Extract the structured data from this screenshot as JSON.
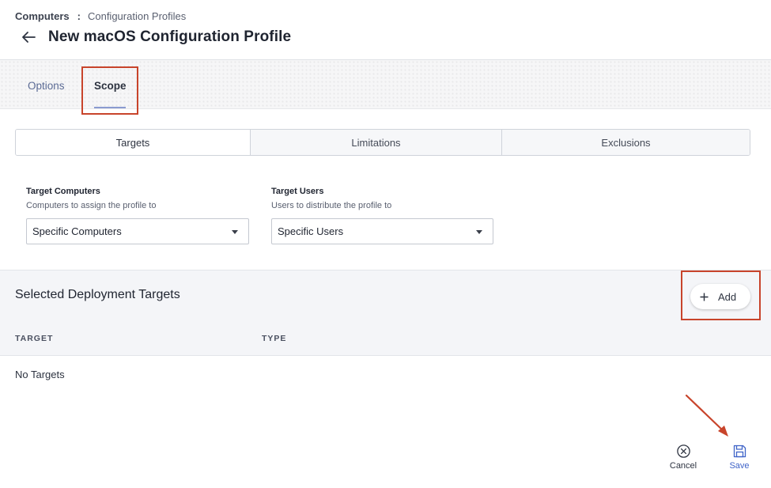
{
  "breadcrumb": {
    "root": "Computers",
    "separator": ":",
    "current": "Configuration Profiles"
  },
  "header": {
    "title": "New macOS Configuration Profile",
    "back_icon": "arrow-left-icon"
  },
  "tabs": [
    {
      "label": "Options",
      "active": false
    },
    {
      "label": "Scope",
      "active": true
    }
  ],
  "scope_tabs": [
    {
      "label": "Targets",
      "active": true
    },
    {
      "label": "Limitations",
      "active": false
    },
    {
      "label": "Exclusions",
      "active": false
    }
  ],
  "target_computers": {
    "label": "Target Computers",
    "help": "Computers to assign the profile to",
    "value": "Specific Computers"
  },
  "target_users": {
    "label": "Target Users",
    "help": "Users to distribute the profile to",
    "value": "Specific Users"
  },
  "deployment": {
    "title": "Selected Deployment Targets",
    "add_label": "Add",
    "columns": [
      "TARGET",
      "TYPE"
    ],
    "empty_text": "No Targets"
  },
  "footer": {
    "cancel_label": "Cancel",
    "save_label": "Save"
  },
  "colors": {
    "accent": "#3f63c8",
    "annotation": "#c8442b",
    "tab_underline": "#8a9bd0"
  }
}
